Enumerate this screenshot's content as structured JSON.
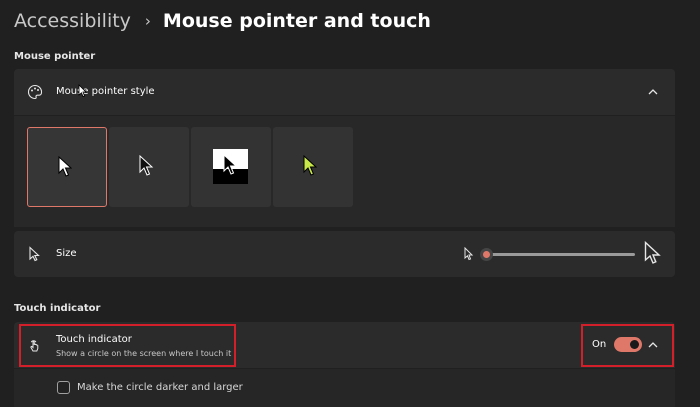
{
  "breadcrumb": {
    "parent": "Accessibility",
    "separator": "›",
    "current": "Mouse pointer and touch"
  },
  "mouse_pointer_section": {
    "label": "Mouse pointer",
    "style_row": {
      "label": "Mouse pointer style",
      "icon": "palette-icon",
      "expand_icon": "chevron-up-icon"
    },
    "styles": [
      {
        "name": "white-pointer",
        "selected": true
      },
      {
        "name": "black-pointer",
        "selected": false
      },
      {
        "name": "inverted-pointer",
        "selected": false
      },
      {
        "name": "custom-color-pointer",
        "selected": false,
        "color": "#c8e84a"
      }
    ],
    "size_row": {
      "label": "Size",
      "icon": "pointer-icon",
      "slider_value": 0.0
    }
  },
  "touch_section": {
    "label": "Touch indicator",
    "row": {
      "title": "Touch indicator",
      "description": "Show a circle on the screen where I touch it",
      "icon": "touch-icon",
      "state_label": "On",
      "toggle_on": true,
      "expand_icon": "chevron-up-icon"
    },
    "darker_option": {
      "label": "Make the circle darker and larger",
      "checked": false
    }
  },
  "colors": {
    "accent": "#e0786a",
    "highlight": "#d21f2a",
    "background": "#202020",
    "card": "#2b2b2b"
  }
}
